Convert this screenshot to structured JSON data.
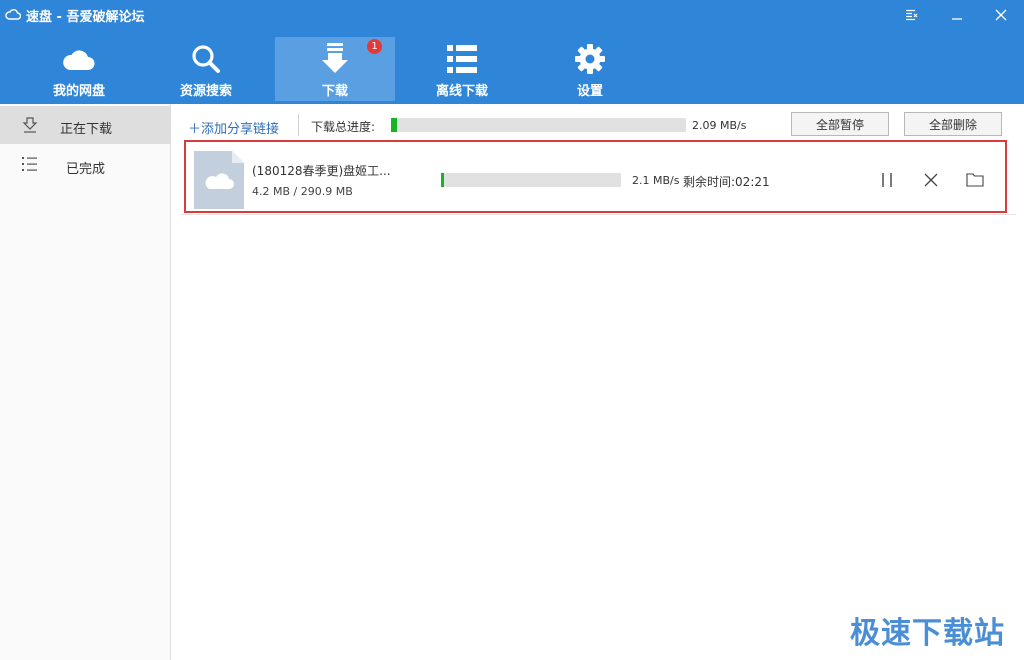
{
  "window": {
    "title": "速盘 - 吾爱破解论坛"
  },
  "toolbar": {
    "items": [
      {
        "label": "我的网盘",
        "icon": "cloud-icon"
      },
      {
        "label": "资源搜索",
        "icon": "search-icon"
      },
      {
        "label": "下载",
        "icon": "download-icon",
        "badge": "1",
        "active": true
      },
      {
        "label": "离线下载",
        "icon": "list-icon"
      },
      {
        "label": "设置",
        "icon": "gear-icon"
      }
    ]
  },
  "sidebar": {
    "items": [
      {
        "label": "正在下载",
        "icon": "download-tray-icon",
        "active": true
      },
      {
        "label": "已完成",
        "icon": "list-bullets-icon"
      }
    ]
  },
  "topbar": {
    "add_link": "＋添加分享链接",
    "total_progress_label": "下载总进度:",
    "total_progress": 0.02,
    "total_speed": "2.09 MB/s",
    "pause_all": "全部暂停",
    "delete_all": "全部删除"
  },
  "downloads": [
    {
      "name": "(180128春季更)盘姬工...",
      "size": "4.2 MB / 290.9 MB",
      "progress": 0.015,
      "speed": "2.1 MB/s",
      "remaining": "剩余时间:02:21"
    }
  ],
  "watermark": "极速下载站",
  "colors": {
    "accent": "#2f85d8",
    "progress": "#16b325",
    "highlight": "#d83b3b"
  }
}
